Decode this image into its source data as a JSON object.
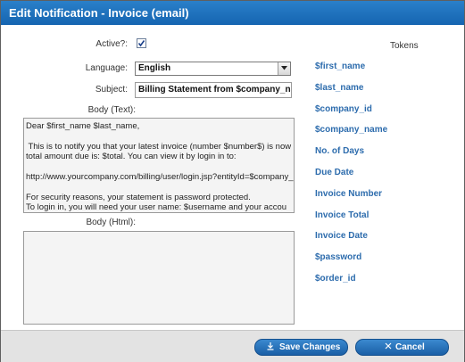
{
  "dialog": {
    "title": "Edit Notification - Invoice (email)"
  },
  "form": {
    "active_label": "Active?:",
    "active_checked": true,
    "language_label": "Language:",
    "language_value": "English",
    "subject_label": "Subject:",
    "subject_value": "Billing Statement from $company_nar",
    "body_text_label": "Body (Text):",
    "body_text_lines": [
      "Dear $first_name $last_name,",
      "",
      " This is to notify you that your latest invoice (number $number$) is now",
      "total amount due is: $total. You can view it by login in to:",
      "",
      "http://www.yourcompany.com/billing/user/login.jsp?entityId=$company_",
      "",
      "For security reasons, your statement is password protected.",
      "To login in, you will need your user name: $username and your accou"
    ],
    "body_html_label": "Body (Html):",
    "body_html_value": ""
  },
  "tokens": {
    "title": "Tokens",
    "items": [
      "$first_name",
      "$last_name",
      "$company_id",
      "$company_name",
      "No. of Days",
      "Due Date",
      "Invoice Number",
      "Invoice Total",
      "Invoice Date",
      "$password",
      "$order_id"
    ]
  },
  "footer": {
    "save_label": "Save Changes",
    "save_icon": "save-arrow-icon",
    "cancel_label": "Cancel",
    "cancel_icon": "close-icon"
  }
}
